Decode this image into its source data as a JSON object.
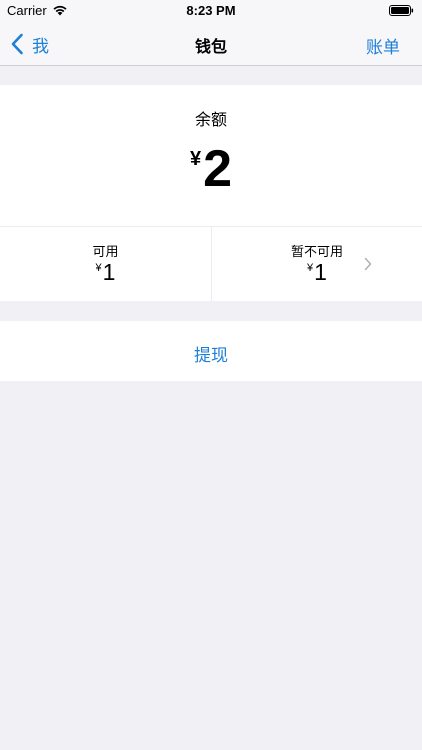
{
  "status_bar": {
    "carrier": "Carrier",
    "time": "8:23 PM"
  },
  "nav": {
    "back_label": "我",
    "title": "钱包",
    "right_label": "账单"
  },
  "balance": {
    "label": "余额",
    "currency": "¥",
    "amount": "2"
  },
  "available": {
    "label": "可用",
    "currency": "¥",
    "amount": "1"
  },
  "unavailable": {
    "label": "暂不可用",
    "currency": "¥",
    "amount": "1"
  },
  "actions": {
    "withdraw_label": "提现"
  },
  "colors": {
    "accent": "#1e7fd8",
    "background": "#f0f0f5"
  }
}
